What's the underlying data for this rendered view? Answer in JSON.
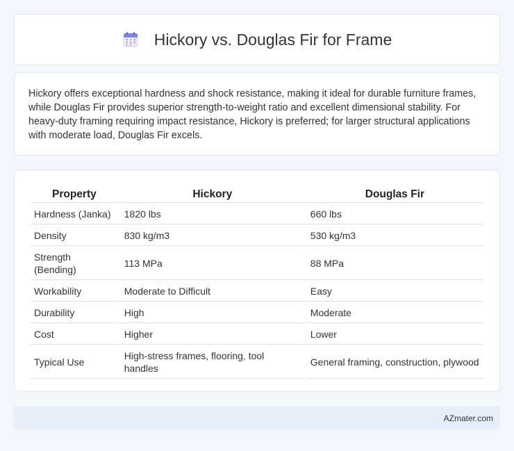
{
  "header": {
    "icon": "calendar-icon",
    "title": "Hickory vs. Douglas Fir for Frame"
  },
  "summary": {
    "text": "Hickory offers exceptional hardness and shock resistance, making it ideal for durable furniture frames, while Douglas Fir provides superior strength-to-weight ratio and excellent dimensional stability. For heavy-duty framing requiring impact resistance, Hickory is preferred; for larger structural applications with moderate load, Douglas Fir excels."
  },
  "table": {
    "headers": [
      "Property",
      "Hickory",
      "Douglas Fir"
    ],
    "rows": [
      [
        "Hardness (Janka)",
        "1820 lbs",
        "660 lbs"
      ],
      [
        "Density",
        "830 kg/m3",
        "530 kg/m3"
      ],
      [
        "Strength (Bending)",
        "113 MPa",
        "88 MPa"
      ],
      [
        "Workability",
        "Moderate to Difficult",
        "Easy"
      ],
      [
        "Durability",
        "High",
        "Moderate"
      ],
      [
        "Cost",
        "Higher",
        "Lower"
      ],
      [
        "Typical Use",
        "High-stress frames, flooring, tool handles",
        "General framing, construction, plywood"
      ]
    ]
  },
  "footer": {
    "text": "AZmater.com"
  }
}
